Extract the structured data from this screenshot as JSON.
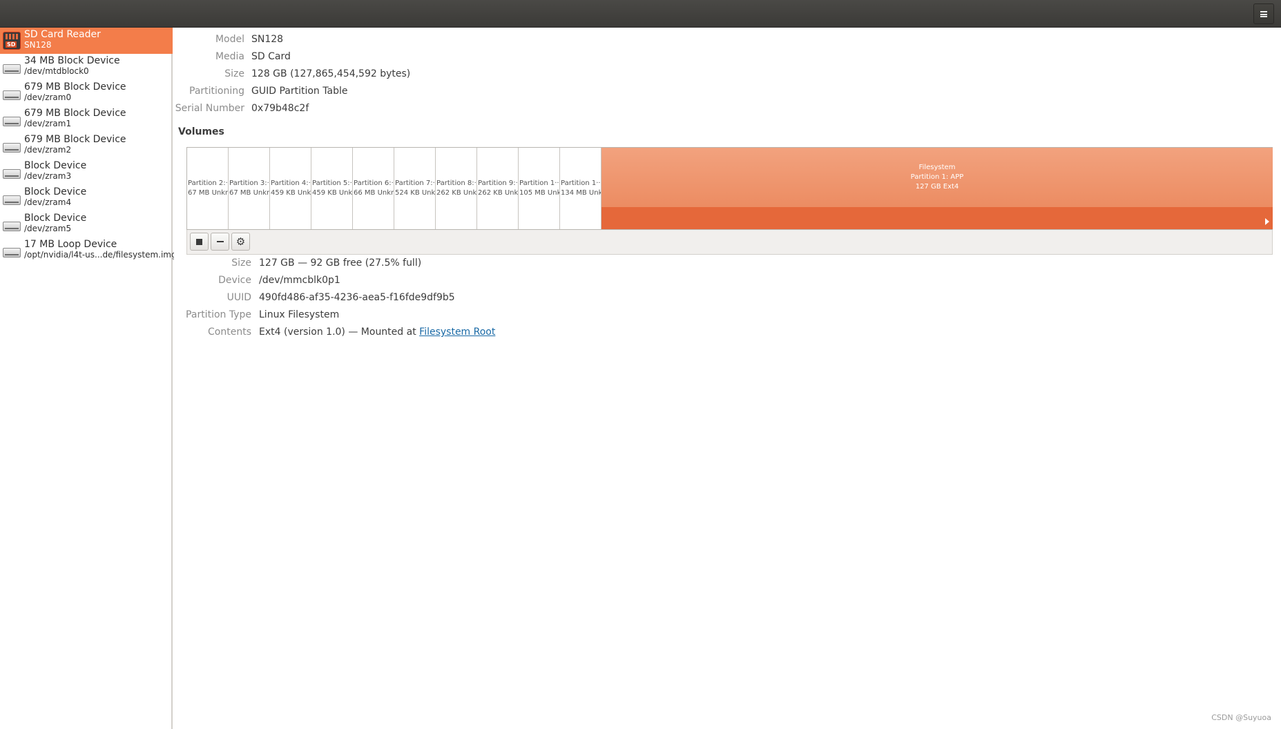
{
  "header": {
    "menu_icon": "hamburger-menu-icon"
  },
  "sidebar": {
    "items": [
      {
        "name": "SD Card Reader",
        "sub": "SN128",
        "icon": "sd-card-icon",
        "selected": true
      },
      {
        "name": "34 MB Block Device",
        "sub": "/dev/mtdblock0",
        "icon": "drive-icon"
      },
      {
        "name": "679 MB Block Device",
        "sub": "/dev/zram0",
        "icon": "drive-icon"
      },
      {
        "name": "679 MB Block Device",
        "sub": "/dev/zram1",
        "icon": "drive-icon"
      },
      {
        "name": "679 MB Block Device",
        "sub": "/dev/zram2",
        "icon": "drive-icon"
      },
      {
        "name": "Block Device",
        "sub": "/dev/zram3",
        "icon": "drive-icon"
      },
      {
        "name": "Block Device",
        "sub": "/dev/zram4",
        "icon": "drive-icon"
      },
      {
        "name": "Block Device",
        "sub": "/dev/zram5",
        "icon": "drive-icon"
      },
      {
        "name": "17 MB Loop Device",
        "sub": "/opt/nvidia/l4t-us...de/filesystem.img",
        "icon": "drive-icon"
      }
    ]
  },
  "drive": {
    "model_label": "Model",
    "model": "SN128",
    "media_label": "Media",
    "media": "SD Card",
    "size_label": "Size",
    "size": "128 GB (127,865,454,592 bytes)",
    "partitioning_label": "Partitioning",
    "partitioning": "GUID Partition Table",
    "serial_label": "Serial Number",
    "serial": "0x79b48c2f"
  },
  "volumes": {
    "title": "Volumes",
    "partitions": [
      {
        "name": "Partition 2:···",
        "size": "67 MB Unkn···"
      },
      {
        "name": "Partition 3:···",
        "size": "67 MB Unkn···"
      },
      {
        "name": "Partition 4:···",
        "size": "459 KB Unk···"
      },
      {
        "name": "Partition 5:···",
        "size": "459 KB Unk···"
      },
      {
        "name": "Partition 6:···",
        "size": "66 MB Unkn···"
      },
      {
        "name": "Partition 7:···",
        "size": "524 KB Unk···"
      },
      {
        "name": "Partition 8:···",
        "size": "262 KB Unk···"
      },
      {
        "name": "Partition 9:···",
        "size": "262 KB Unk···"
      },
      {
        "name": "Partition 1···",
        "size": "105 MB Unk···"
      },
      {
        "name": "Partition 1···",
        "size": "134 MB Unk···"
      }
    ],
    "main_partition": {
      "line1": "Filesystem",
      "line2": "Partition 1: APP",
      "line3": "127 GB Ext4"
    },
    "toolbar": {
      "stop_icon": "stop-icon",
      "remove_icon": "minus-icon",
      "settings_icon": "gears-icon"
    }
  },
  "selected_volume": {
    "size_label": "Size",
    "size": "127 GB — 92 GB free (27.5% full)",
    "device_label": "Device",
    "device": "/dev/mmcblk0p1",
    "uuid_label": "UUID",
    "uuid": "490fd486-af35-4236-aea5-f16fde9df9b5",
    "ptype_label": "Partition Type",
    "ptype": "Linux Filesystem",
    "contents_label": "Contents",
    "contents_prefix": "Ext4 (version 1.0) — Mounted at ",
    "contents_link": "Filesystem Root"
  },
  "watermark": "CSDN @Suyuoa",
  "colors": {
    "accent": "#f37d4a",
    "headerbar": "#3f3e3b",
    "volume_fill": "#ec8c62",
    "volume_base": "#e5683a"
  }
}
